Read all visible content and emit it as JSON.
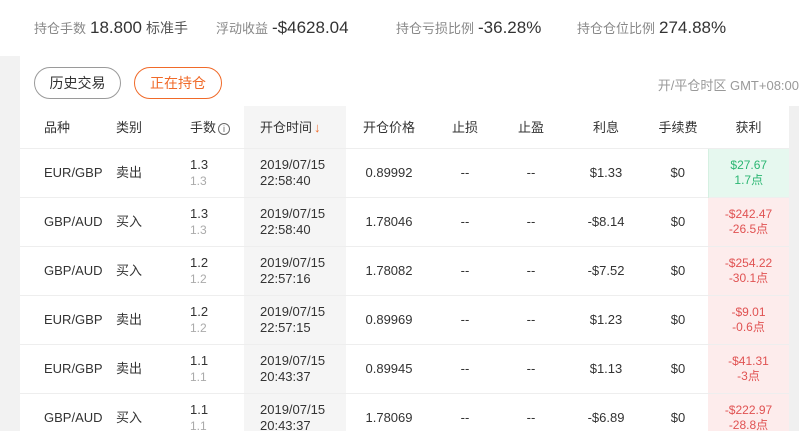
{
  "summary": {
    "lots_label": "持仓手数",
    "lots_value": "18.800",
    "lots_unit": "标准手",
    "float_label": "浮动收益",
    "float_value": "-$4628.04",
    "loss_ratio_label": "持仓亏损比例",
    "loss_ratio_value": "-36.28%",
    "position_ratio_label": "持仓仓位比例",
    "position_ratio_value": "274.88%"
  },
  "tabs": {
    "history_label": "历史交易",
    "open_label": "正在持仓"
  },
  "timezone_label": "开/平仓时区 GMT+08:00",
  "colors": {
    "accent": "#f06a29",
    "profit": "#2bb672",
    "loss": "#e05252"
  },
  "table": {
    "headers": {
      "symbol": "品种",
      "type": "类别",
      "lots": "手数",
      "open_time": "开仓时间",
      "open_price": "开仓价格",
      "stop_loss": "止损",
      "take_profit": "止盈",
      "interest": "利息",
      "fee": "手续费",
      "profit": "获利"
    },
    "icons": {
      "info": "info-circle-icon",
      "sort": "arrow-down-icon"
    },
    "rows": [
      {
        "symbol": "EUR/GBP",
        "type": "卖出",
        "lots": "1.3",
        "lots_sub": "1.3",
        "date": "2019/07/15",
        "time": "22:58:40",
        "price": "0.89992",
        "sl": "--",
        "tp": "--",
        "interest": "$1.33",
        "fee": "$0",
        "profit": "$27.67",
        "points": "1.7点",
        "sign": "pos"
      },
      {
        "symbol": "GBP/AUD",
        "type": "买入",
        "lots": "1.3",
        "lots_sub": "1.3",
        "date": "2019/07/15",
        "time": "22:58:40",
        "price": "1.78046",
        "sl": "--",
        "tp": "--",
        "interest": "-$8.14",
        "fee": "$0",
        "profit": "-$242.47",
        "points": "-26.5点",
        "sign": "neg"
      },
      {
        "symbol": "GBP/AUD",
        "type": "买入",
        "lots": "1.2",
        "lots_sub": "1.2",
        "date": "2019/07/15",
        "time": "22:57:16",
        "price": "1.78082",
        "sl": "--",
        "tp": "--",
        "interest": "-$7.52",
        "fee": "$0",
        "profit": "-$254.22",
        "points": "-30.1点",
        "sign": "neg"
      },
      {
        "symbol": "EUR/GBP",
        "type": "卖出",
        "lots": "1.2",
        "lots_sub": "1.2",
        "date": "2019/07/15",
        "time": "22:57:15",
        "price": "0.89969",
        "sl": "--",
        "tp": "--",
        "interest": "$1.23",
        "fee": "$0",
        "profit": "-$9.01",
        "points": "-0.6点",
        "sign": "neg"
      },
      {
        "symbol": "EUR/GBP",
        "type": "卖出",
        "lots": "1.1",
        "lots_sub": "1.1",
        "date": "2019/07/15",
        "time": "20:43:37",
        "price": "0.89945",
        "sl": "--",
        "tp": "--",
        "interest": "$1.13",
        "fee": "$0",
        "profit": "-$41.31",
        "points": "-3点",
        "sign": "neg"
      },
      {
        "symbol": "GBP/AUD",
        "type": "买入",
        "lots": "1.1",
        "lots_sub": "1.1",
        "date": "2019/07/15",
        "time": "20:43:37",
        "price": "1.78069",
        "sl": "--",
        "tp": "--",
        "interest": "-$6.89",
        "fee": "$0",
        "profit": "-$222.97",
        "points": "-28.8点",
        "sign": "neg"
      }
    ]
  }
}
